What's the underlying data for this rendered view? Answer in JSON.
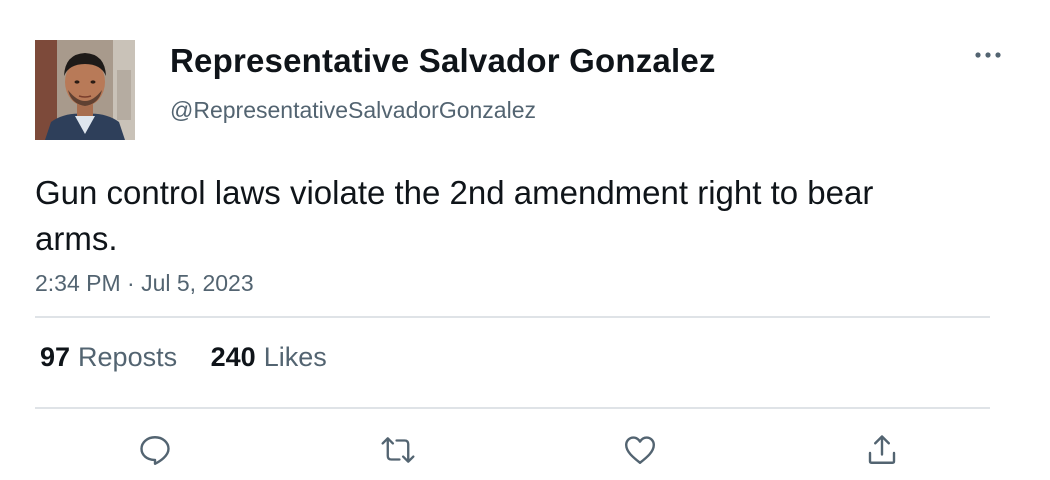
{
  "tweet": {
    "author": {
      "display_name": "Representative Salvador Gonzalez",
      "handle": "@RepresentativeSalvadorGonzalez"
    },
    "text": "Gun control laws violate the 2nd amendment right to bear arms.",
    "timestamp": "2:34 PM · Jul 5, 2023",
    "stats": {
      "reposts_count": "97",
      "reposts_label": "Reposts",
      "likes_count": "240",
      "likes_label": "Likes"
    }
  },
  "icons": {
    "more": "more-horizontal-icon",
    "reply": "reply-icon",
    "repost": "repost-icon",
    "like": "like-icon",
    "share": "share-icon"
  },
  "colors": {
    "text_primary": "#0f1419",
    "text_secondary": "#536471",
    "divider": "#dfe3e7"
  }
}
